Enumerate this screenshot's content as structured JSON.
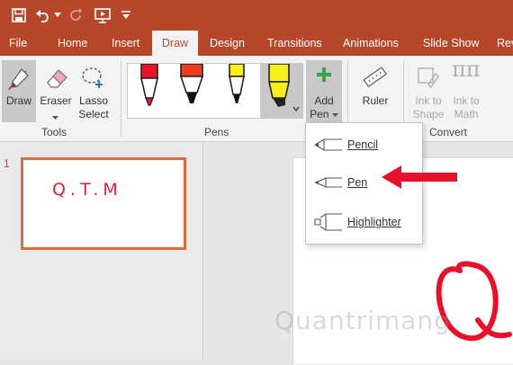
{
  "qat": {
    "save_icon": "save-icon",
    "undo_icon": "undo-icon",
    "redo_icon": "redo-icon",
    "present_icon": "start-from-beginning-icon",
    "customize_icon": "customize-quick-access-icon"
  },
  "tabs": [
    {
      "label": "File"
    },
    {
      "label": "Home"
    },
    {
      "label": "Insert"
    },
    {
      "label": "Draw"
    },
    {
      "label": "Design"
    },
    {
      "label": "Transitions"
    },
    {
      "label": "Animations"
    },
    {
      "label": "Slide Show"
    },
    {
      "label": "Rev"
    }
  ],
  "ribbon": {
    "tools": {
      "draw": "Draw",
      "eraser": "Eraser",
      "lasso_line1": "Lasso",
      "lasso_line2": "Select",
      "group": "Tools"
    },
    "pens": {
      "group": "Pens",
      "items": [
        {
          "name": "red pen",
          "color": "#e8152a"
        },
        {
          "name": "red-orange marker",
          "color": "#ef3b1f"
        },
        {
          "name": "yellow pen",
          "color": "#f7ef1c"
        },
        {
          "name": "yellow highlighter",
          "color": "#f7ef1c"
        }
      ]
    },
    "add_pen_line1": "Add",
    "add_pen_line2": "Pen",
    "ruler": "Ruler",
    "ink_to_shape_line1": "Ink to",
    "ink_to_shape_line2": "Shape",
    "ink_to_math_line1": "Ink to",
    "ink_to_math_line2": "Math",
    "convert_group": "Convert"
  },
  "add_pen_menu": {
    "items": [
      {
        "label": "Pencil"
      },
      {
        "label": "Pen"
      },
      {
        "label": "Highlighter"
      }
    ]
  },
  "slides": {
    "thumb_number": "1",
    "thumb_text": "Q.T.M"
  },
  "watermark": "Quantrimang",
  "colors": {
    "accent": "#b7472a",
    "arrow": "#e8102a",
    "ink": "#e8102a"
  }
}
